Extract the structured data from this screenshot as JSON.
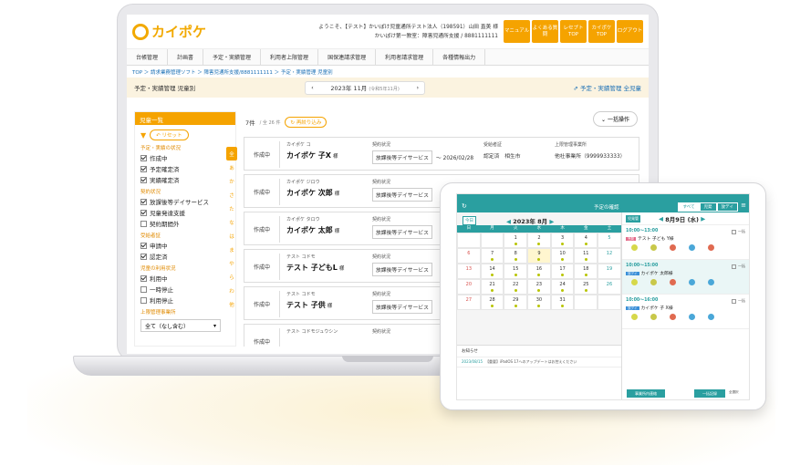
{
  "laptop": {
    "logo_text": "カイポケ",
    "welcome_line1": "ようこそ、【テスト】かいぽけ児童通所テスト法人（198591）山田 直美 様",
    "welcome_line2": "かいぽけ第一教室：障害児通所支援 / 8881111111",
    "header_buttons": [
      "マニュアル",
      "よくある質問",
      "レセプトTOP",
      "カイポケTOP",
      "ログアウト"
    ],
    "nav": [
      "台帳管理",
      "計画書",
      "予定・実績管理",
      "利用者上限管理",
      "国保連請求管理",
      "利用者請求管理",
      "各種情報出力"
    ],
    "breadcrumb": "TOP ＞ 請求業務管理ソフト ＞ 障害児通所支援/8881111111 ＞ 予定・実績管理 児童別",
    "page_title": "予定・実績管理 児童別",
    "month_label": "2023年 11月",
    "month_sub": "(令和5年11月)",
    "right_link": "予定・実績管理 全児童",
    "sidebar": {
      "title": "児童一覧",
      "reset": "リセット",
      "group1": "予定・実績の状況",
      "g1_items": [
        {
          "label": "作成中",
          "checked": true
        },
        {
          "label": "予定確定済",
          "checked": true
        },
        {
          "label": "実績確定済",
          "checked": true
        }
      ],
      "group2": "契約状況",
      "g2_items": [
        {
          "label": "放課後等デイサービス",
          "checked": true
        },
        {
          "label": "児童発達支援",
          "checked": true
        },
        {
          "label": "契約期間外",
          "checked": false
        }
      ],
      "group3": "受給者証",
      "g3_items": [
        {
          "label": "申請中",
          "checked": true
        },
        {
          "label": "認定済",
          "checked": true
        }
      ],
      "group4": "児童の利用状況",
      "g4_items": [
        {
          "label": "利用中",
          "checked": true
        },
        {
          "label": "一時停止",
          "checked": false
        },
        {
          "label": "利用停止",
          "checked": false
        }
      ],
      "group5": "上限管理事業所",
      "select_value": "全て（なし含む）",
      "kana": [
        "全",
        "あ",
        "か",
        "さ",
        "た",
        "な",
        "は",
        "ま",
        "や",
        "ら",
        "わ",
        "他"
      ]
    },
    "list": {
      "count": "7件",
      "count_total": "/ 全 26 件",
      "narrow": "再絞り込み",
      "bulk": "一括操作",
      "rows": [
        {
          "status": "作成中",
          "kana": "カイポケ コ",
          "name": "カイポケ 子X",
          "suffix": "様",
          "contract_label": "契約状況",
          "service": "放課後等デイサービス",
          "date": "～ 2026/02/28",
          "recip_label": "受給者証",
          "recip": "認定済　相生市",
          "office_label": "上限管理事業所",
          "office": "他社事業所（9999933333）"
        },
        {
          "status": "作成中",
          "kana": "カイポケ ジロウ",
          "name": "カイポケ 次郎",
          "suffix": "様",
          "contract_label": "契約状況",
          "service": "放課後等デイサービス",
          "date": "",
          "recip_label": "",
          "recip": "",
          "office_label": "",
          "office": ""
        },
        {
          "status": "作成中",
          "kana": "カイポケ タロウ",
          "name": "カイポケ 太郎",
          "suffix": "様",
          "contract_label": "契約状況",
          "service": "放課後等デイサービス",
          "date": "",
          "recip_label": "",
          "recip": "",
          "office_label": "",
          "office": ""
        },
        {
          "status": "作成中",
          "kana": "テスト コドモ",
          "name": "テスト 子どもL",
          "suffix": "様",
          "contract_label": "契約状況",
          "service": "放課後等デイサービス",
          "date": "",
          "recip_label": "",
          "recip": "",
          "office_label": "",
          "office": ""
        },
        {
          "status": "作成中",
          "kana": "テスト コドモ",
          "name": "テスト 子供",
          "suffix": "様",
          "contract_label": "契約状況",
          "service": "放課後等デイサービス",
          "date": "",
          "recip_label": "",
          "recip": "",
          "office_label": "",
          "office": ""
        },
        {
          "status": "作成中",
          "kana": "テスト コドモジュウシン",
          "name": "",
          "suffix": "",
          "contract_label": "契約状況",
          "service": "",
          "date": "",
          "recip_label": "",
          "recip": "",
          "office_label": "",
          "office": ""
        }
      ]
    }
  },
  "tablet": {
    "title": "予定の確認",
    "segments": [
      "すべて",
      "児発",
      "放デイ"
    ],
    "today": "今日",
    "month": "2023年 8月",
    "weekdays": [
      "日",
      "月",
      "火",
      "水",
      "木",
      "金",
      "土"
    ],
    "weeks": [
      [
        "",
        "",
        "1",
        "2",
        "3",
        "4",
        "5"
      ],
      [
        "6",
        "7",
        "8",
        "9",
        "10",
        "11",
        "12"
      ],
      [
        "13",
        "14",
        "15",
        "16",
        "17",
        "18",
        "19"
      ],
      [
        "20",
        "21",
        "22",
        "23",
        "24",
        "25",
        "26"
      ],
      [
        "27",
        "28",
        "29",
        "30",
        "31",
        "",
        ""
      ]
    ],
    "notice_title": "お知らせ",
    "notice_date": "2023/08/15",
    "notice_text": "【重要】iPadOS 17へのアップデートはお控えください",
    "day_label": "8月9日 (水)",
    "day_badge": "児発管",
    "blocks": [
      {
        "time": "10:00～13:00",
        "tag": "児発",
        "name": "テスト 子ども Y様",
        "check": "一括"
      },
      {
        "time": "10:00～15:00",
        "tag": "放デイ",
        "name": "カイポケ 太郎様",
        "check": "一括"
      },
      {
        "time": "10:00～16:00",
        "tag": "放デイ",
        "name": "カイポケ 子 X様",
        "check": "一括"
      }
    ],
    "footer_left": "事業所内連絡",
    "footer_btn": "一括記録",
    "footer_chk": "全選択"
  }
}
